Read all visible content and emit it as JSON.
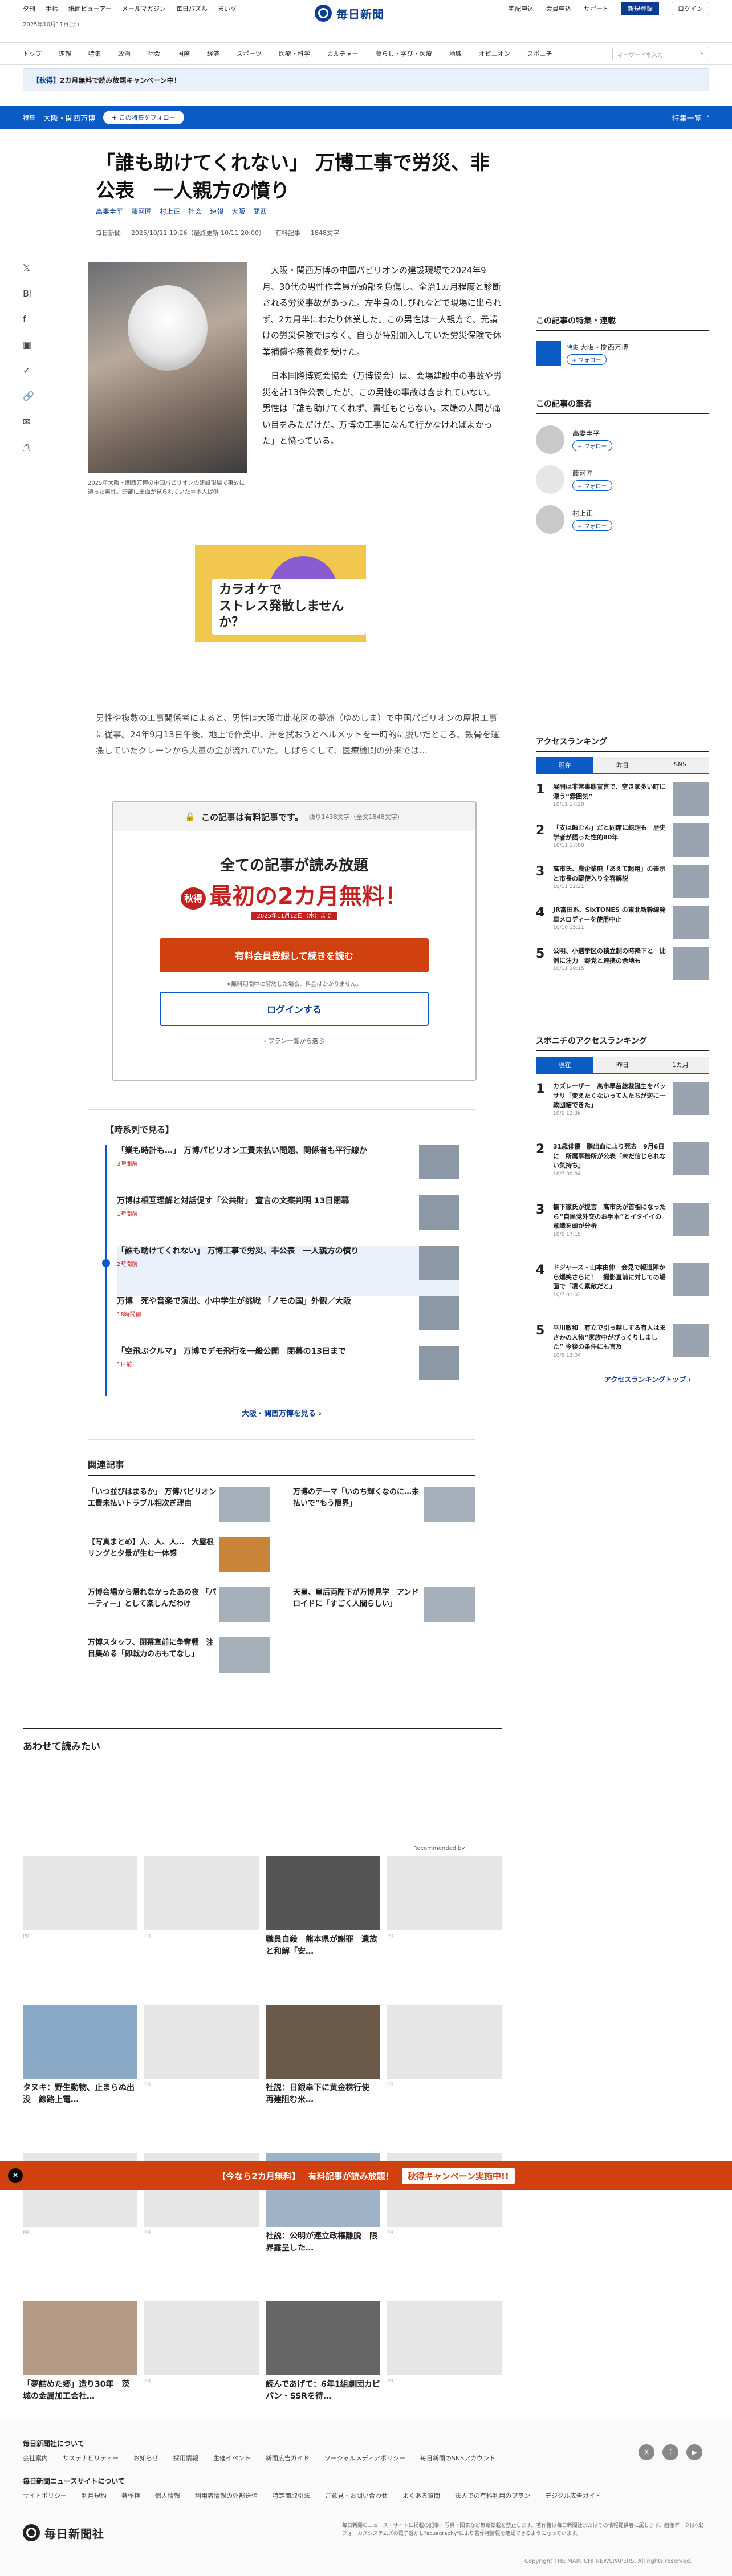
{
  "topbar": {
    "left": [
      "夕刊",
      "手帳",
      "紙面ビューアー",
      "メールマガジン",
      "毎日パズル",
      "まいダ"
    ],
    "right": [
      "宅配申込",
      "会員申込",
      "サポート"
    ],
    "register": "新規登録",
    "login": "ログイン"
  },
  "logo": "毎日新聞",
  "date": "2025年10月11日(土)",
  "nav": {
    "items": [
      "トップ",
      "速報",
      "特集",
      "政治",
      "社会",
      "国際",
      "経済",
      "スポーツ",
      "医療・科学",
      "カルチャー",
      "暮らし・学び・医療",
      "地域",
      "オピニオン",
      "スポニチ"
    ],
    "search_placeholder": "キーワードを入力"
  },
  "campaign": {
    "em": "【秋得】",
    "text": "2カ月無料で読み放題キャンペーン中！"
  },
  "special": {
    "tag": "特集",
    "name": "大阪・関西万博",
    "follow": "+ この特集をフォロー",
    "right": "特集一覧"
  },
  "article": {
    "title": "「誰も助けてくれない」 万博工事で労災、非公表　一人親方の憤り",
    "authors": [
      "高妻圭平",
      "藤河匠",
      "村上正"
    ],
    "tags": [
      "社会",
      "速報",
      "大阪",
      "関西"
    ],
    "source": "毎日新聞",
    "date": "2025/10/11 19:26（最終更新 10/11 20:00）",
    "premium": "有料記事",
    "chars": "1848文字",
    "caption": "2025年大阪・関西万博の中国パビリオンの建設現場で事故に遭った男性。頭部に出血が見られていた＝本人提供",
    "para1": "大阪・関西万博の中国パビリオンの建設現場で2024年9月、30代の男性作業員が頭部を負傷し、全治1カ月程度と診断される労災事故があった。左半身のしびれなどで現場に出られず、2カ月半にわたり休業した。この男性は一人親方で、元請けの労災保険ではなく、自らが特別加入していた労災保険で休業補償や療養費を受けた。",
    "para2": "日本国際博覧会協会（万博協会）は、会場建設中の事故や労災を計13件公表したが、この男性の事故は含まれていない。男性は「誰も助けてくれず、責任もとらない。末端の人間が痛い目をみただけだ。万博の工事になんて行かなければよかった」と憤っている。",
    "para3": "男性や複数の工事関係者によると、男性は大阪市此花区の夢洲（ゆめしま）で中国パビリオンの屋根工事に従事。24年9月13日午後、地上で作業中、汗を拭おうとヘルメットを一時的に脱いだところ、鉄骨を運搬していたクレーンから大量の金が流れていた。しばらくして、医療機関の外来では…",
    "ad_text": "カラオケで\nストレス発散しませんか？"
  },
  "share_icons": [
    "x-icon",
    "hatena-icon",
    "facebook-icon",
    "line-icon",
    "pocket-icon",
    "link-icon",
    "mail-icon",
    "print-icon"
  ],
  "paywall": {
    "header": "この記事は有料記事です。",
    "remaining": "残り1438文字（全文1848文字）",
    "h2": "全ての記事が読み放題",
    "big": "最初の2カ月無料！",
    "badge": "秋得",
    "period": "2025年11月12日（水）まで",
    "cta": "有料会員登録して続きを読む",
    "note": "※無料期間中に解約した場合、料金はかかりません。",
    "login": "ログインする",
    "plan": "プラン一覧から選ぶ"
  },
  "timeline": {
    "header": "【時系列で見る】",
    "items": [
      {
        "title": "「業も時計も…」 万博パビリオン工費未払い問題、関係者も平行線か",
        "date": "3時間前"
      },
      {
        "title": "万博は相互理解と対話促す「公共財」 宣言の文案判明 13日閉幕",
        "date": "1時間前"
      },
      {
        "title": "「誰も助けてくれない」 万博工事で労災、非公表　一人親方の憤り",
        "date": "2時間前"
      },
      {
        "title": "万博　死や音楽で演出、小中学生が挑戦 「ノモの国」外観／大阪",
        "date": "18時間前"
      },
      {
        "title": "「空飛ぶクルマ」 万博でデモ飛行を一般公開　閉幕の13日まで",
        "date": "1日前"
      }
    ],
    "more": "大阪・関西万博を見る"
  },
  "related": {
    "header": "関連記事",
    "items": [
      "「いつ並びはまるか」 万博パビリオン工費未払いトラブル相次ぎ理由",
      "万博のテーマ「いのち輝くなのに…未払いで“もう限界」",
      "【写真まとめ】人、人、人…　大屋根リングと夕景が生む一体感",
      "",
      "万博会場から帰れなかったあの夜 「パーティー」として楽しんだわけ",
      "天皇、皇后両陛下が万博見学　アンドロイドに「すごく人間らしい」",
      "万博スタッフ、閉幕直前に争奪戦　注目集める「即戦力のおもてなし」",
      ""
    ]
  },
  "recommend": {
    "header": "あわせて読みたい",
    "by": "Recommended by",
    "items": [
      {
        "title": "",
        "pr": "PR"
      },
      {
        "title": "",
        "pr": "PR"
      },
      {
        "title": "職員自殺　熊本県が謝罪　遺族と和解「安…",
        "pr": ""
      },
      {
        "title": "",
        "pr": "PR"
      },
      {
        "title": "タヌキ：野生動物、止まらぬ出没　線路上電…",
        "pr": ""
      },
      {
        "title": "",
        "pr": "PR"
      },
      {
        "title": "社説：日銀幸下に黄金株行使　再建阻む米…",
        "pr": ""
      },
      {
        "title": "",
        "pr": "PR"
      },
      {
        "title": "",
        "pr": "PR"
      },
      {
        "title": "",
        "pr": "PR"
      },
      {
        "title": "社説：公明が連立政権離脱　限界露呈した…",
        "pr": ""
      },
      {
        "title": "",
        "pr": "PR"
      },
      {
        "title": "「夢詰めた郷」造り30年　茨城の金属加工会社…",
        "pr": ""
      },
      {
        "title": "",
        "pr": "PR"
      },
      {
        "title": "読んであげて：6年1組劇団カビバン・SSRを待…",
        "pr": ""
      },
      {
        "title": "",
        "pr": "PR"
      }
    ]
  },
  "sidebar": {
    "series_header": "この記事の特集・連載",
    "series": {
      "tag": "特集",
      "name": "大阪・関西万博",
      "follow": "+ フォロー"
    },
    "authors_header": "この記事の筆者",
    "authors": [
      {
        "name": "高妻圭平",
        "follow": "+ フォロー"
      },
      {
        "name": "藤河匠",
        "follow": "+ フォロー"
      },
      {
        "name": "村上正",
        "follow": "+ フォロー"
      }
    ],
    "rank1": {
      "header": "アクセスランキング",
      "tabs": [
        "現在",
        "昨日",
        "SNS"
      ],
      "items": [
        {
          "title": "展開は非常事態宣言で、空き家多い町に漂う“雰囲気”",
          "date": "10/11 17:20"
        },
        {
          "title": "「支は蝕むん」だと同席に総理も　歴史学者が語った性的80年",
          "date": "10/11 17:00"
        },
        {
          "title": "高市氏、農企業廃「あえて起用」の表示と市長の駆使入り全容解説",
          "date": "10/11 12:21"
        },
        {
          "title": "JR富田系、SixTONES の東北新幹線発車メロディーを使用中止",
          "date": "10/10 15:21"
        },
        {
          "title": "公明、小選挙区の積立制の時降下と　比例に注力　野党と連携の余地も",
          "date": "10/11 20:15"
        }
      ]
    },
    "rank2": {
      "header": "スポニチのアクセスランキング",
      "tabs": [
        "現在",
        "昨日",
        "1カ月"
      ],
      "items": [
        {
          "title": "カズレーザー　高市早苗総裁誕生をバッサリ「変えたくないって人たちが逆に一致団結できた」",
          "date": "10/6 12:36"
        },
        {
          "title": "31歳俳優　脂出血により死去　9月6日に　所属事務所が公表「未だ信じられない気持ち」",
          "date": "10/7 00:04"
        },
        {
          "title": "橋下徹氏が提言　高市氏が首相になったら“自民党外交のお手本”とイタイイの意識を頭が分析",
          "date": "10/6 17:15"
        },
        {
          "title": "ドジャース・山本由伸　会見で報道陣から爆笑さらに！　撮影直前に対しての場面で「凄く素敵だと」",
          "date": "10/7 01:02"
        },
        {
          "title": "平川敏和　有立で引っ越しする有人はまさかの人物“家族中がぴっくりしました” 今後の条件にも言及",
          "date": "10/6 13:04"
        }
      ]
    },
    "rank_more": "アクセスランキングトップ"
  },
  "banner": {
    "em": "【今なら2カ月無料】",
    "text": "有料記事が読み放題！",
    "pill": "秋得キャンペーン実施中!!"
  },
  "footer": {
    "h1": "毎日新聞社について",
    "row1": [
      "会社案内",
      "サステナビリティー",
      "お知らせ",
      "採用情報",
      "主催イベント",
      "新聞広告ガイド",
      "ソーシャルメディアポリシー",
      "毎日新聞のSNSアカウント"
    ],
    "h2": "毎日新聞ニュースサイトについて",
    "row2": [
      "サイトポリシー",
      "利用規約",
      "著作権",
      "個人情報",
      "利用者情報の外部送信",
      "特定商取引法",
      "ご意見・お問い合わせ",
      "よくある質問",
      "法人での有料利用のプラン",
      "デジタル広告ガイド"
    ],
    "logo": "毎日新聞社",
    "note": "毎日新聞のニュース・サイトに掲載の記事・写真・図表など無断転載を禁止します。著作権は毎日新聞社またはその情報提供者に属します。画像データは(株)フォーカスシステムズの電子透かし\"acuagraphy\"により著作権情報を確認できるようになっています。",
    "copy": "Copyright THE MAINICHI NEWSPAPERS. All rights reserved."
  }
}
